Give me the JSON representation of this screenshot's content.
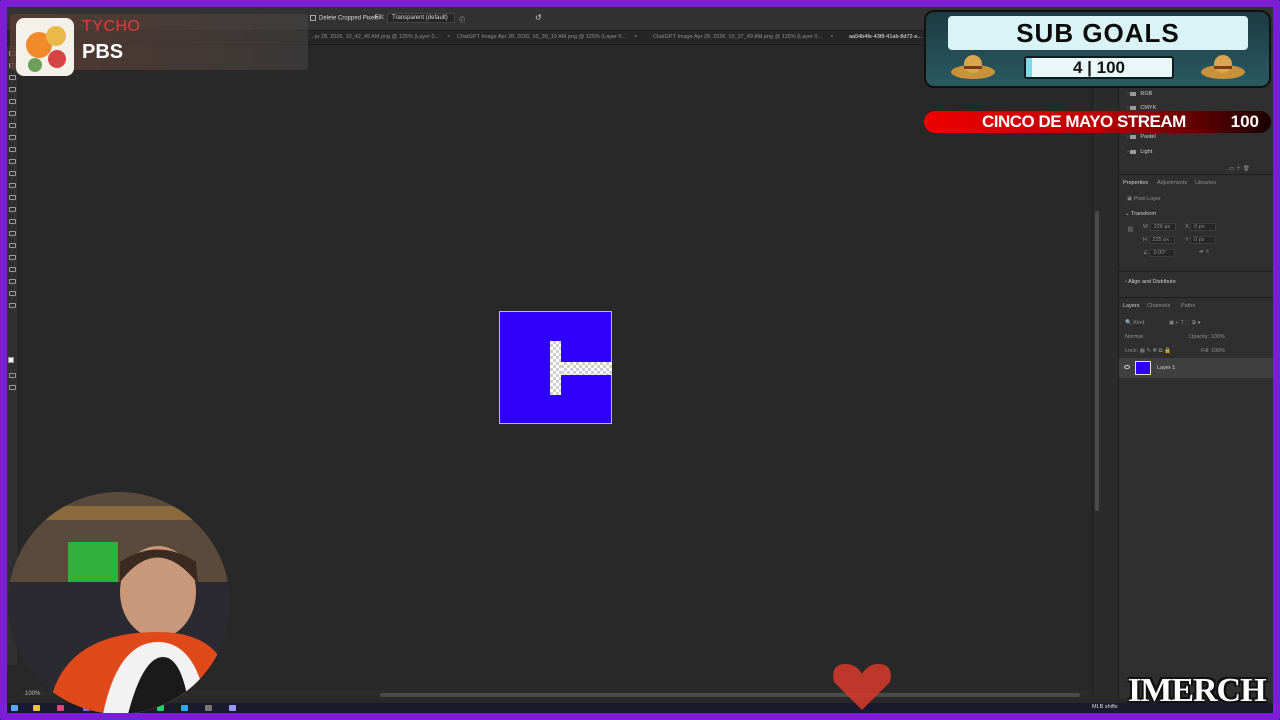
{
  "options_bar": {
    "delete_cropped": "Delete Cropped Pixels",
    "fill_label": "Fill:",
    "fill_value": "Transparent (default)"
  },
  "tabs": [
    {
      "label": "...pr 28, 2026, 10_42_49 AM.png @ 125% (Layer 0..."
    },
    {
      "label": "ChatGPT Image Apr 28, 2026, 10_39_19 AM.png @ 125% (Layer 0..."
    },
    {
      "label": "ChatGPT Image Apr 28, 2026, 10_37_49 AM.png @ 125% (Layer 0..."
    },
    {
      "label": "aa54b4fe-43f8-41ab-8d72-e..."
    }
  ],
  "zoom": "100%",
  "swatch_groups": [
    "RGB",
    "CMYK",
    "Pastel",
    "Light"
  ],
  "properties": {
    "tabs": [
      "Properties",
      "Adjustments",
      "Libraries"
    ],
    "layer_type": "Pixel Layer",
    "transform_title": "Transform",
    "w_label": "W",
    "w_value": "226 px",
    "h_label": "H",
    "h_value": "225 px",
    "x_label": "X",
    "x_value": "0 px",
    "y_label": "Y",
    "y_value": "0 px",
    "angle": "0.00°",
    "align_title": "Align and Distribute"
  },
  "layers": {
    "tabs": [
      "Layers",
      "Channels",
      "Paths"
    ],
    "filter": "Kind",
    "blend": "Normal",
    "opacity_label": "Opacity:",
    "opacity_value": "100%",
    "lock_label": "Lock:",
    "fill_label": "Fill:",
    "fill_value": "100%",
    "items": [
      {
        "name": "Layer 1"
      }
    ]
  },
  "channel_badge": {
    "line1": "TYCHO",
    "line2": "PBS"
  },
  "sub_goals": {
    "title": "SUB GOALS",
    "current": "4",
    "target": "100",
    "progress": 0.04
  },
  "cinco": {
    "text": "CINCO DE MAYO STREAM",
    "value": "100"
  },
  "watermark": "IMERCH",
  "taskbar": {
    "tray_text": "MLB shifts"
  },
  "colors": {
    "frame": "#7a1fd6",
    "doc_fill": "#3000ff",
    "accent_red": "#e00000"
  }
}
